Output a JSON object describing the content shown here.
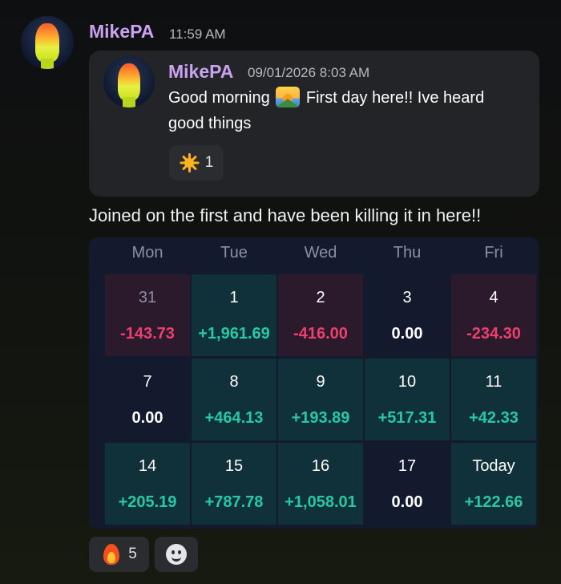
{
  "message": {
    "author": "MikePA",
    "time": "11:59 AM",
    "text": "Joined on the first and have been killing it in here!!",
    "reactions": [
      {
        "icon": "fire-icon",
        "count": "5"
      },
      {
        "icon": "add-reaction-smile-icon"
      }
    ]
  },
  "quoted": {
    "author": "MikePA",
    "timestamp": "09/01/2026 8:03 AM",
    "text_before_emoji": "Good morning",
    "emoji": "sunrise-over-mountains-icon",
    "text_after_emoji": "First day here!! Ive heard good things",
    "reaction": {
      "icon": "sun-icon",
      "count": "1"
    }
  },
  "calendar": {
    "days": [
      "Mon",
      "Tue",
      "Wed",
      "Thu",
      "Fri"
    ],
    "colors": {
      "negative": "#ef3f6c",
      "positive": "#27c9a4",
      "neutral": "#ffffff"
    },
    "weeks": [
      [
        {
          "date": "31",
          "pnl": "-143.73",
          "kind": "neg",
          "muted": true
        },
        {
          "date": "1",
          "pnl": "+1,961.69",
          "kind": "pos"
        },
        {
          "date": "2",
          "pnl": "-416.00",
          "kind": "neg"
        },
        {
          "date": "3",
          "pnl": "0.00",
          "kind": "zero"
        },
        {
          "date": "4",
          "pnl": "-234.30",
          "kind": "neg"
        }
      ],
      [
        {
          "date": "7",
          "pnl": "0.00",
          "kind": "zero"
        },
        {
          "date": "8",
          "pnl": "+464.13",
          "kind": "pos"
        },
        {
          "date": "9",
          "pnl": "+193.89",
          "kind": "pos"
        },
        {
          "date": "10",
          "pnl": "+517.31",
          "kind": "pos"
        },
        {
          "date": "11",
          "pnl": "+42.33",
          "kind": "pos"
        }
      ],
      [
        {
          "date": "14",
          "pnl": "+205.19",
          "kind": "pos"
        },
        {
          "date": "15",
          "pnl": "+787.78",
          "kind": "pos"
        },
        {
          "date": "16",
          "pnl": "+1,058.01",
          "kind": "pos"
        },
        {
          "date": "17",
          "pnl": "0.00",
          "kind": "zero"
        },
        {
          "date": "Today",
          "pnl": "+122.66",
          "kind": "pos"
        }
      ]
    ]
  }
}
